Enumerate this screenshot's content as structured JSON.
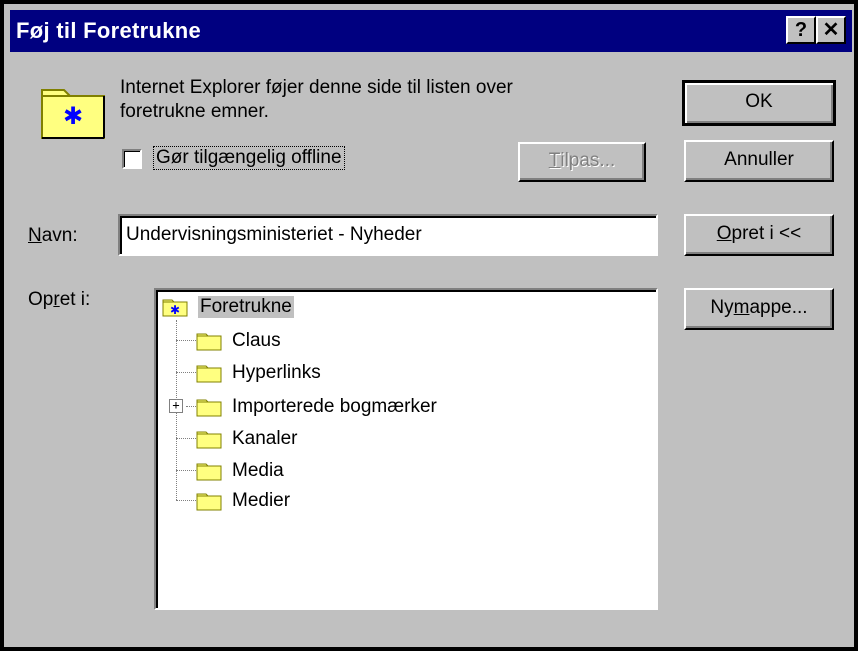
{
  "window": {
    "title": "Føj til Foretrukne",
    "help_glyph": "?",
    "close_glyph": "✕"
  },
  "info": {
    "line1": "Internet Explorer føjer denne side til listen over",
    "line2": "foretrukne emner."
  },
  "offline": {
    "label_pre": "G",
    "label_mid": "ø",
    "label_rest": "r tilgængelig offline",
    "checked": false
  },
  "buttons": {
    "tilpas_u": "T",
    "tilpas_rest": "ilpas...",
    "ok": "OK",
    "cancel": "Annuller",
    "create_in_u": "O",
    "create_in_rest": "pret i <<",
    "new_folder_pre": "Ny ",
    "new_folder_u": "m",
    "new_folder_rest": "appe..."
  },
  "name": {
    "label_u": "N",
    "label_rest": "avn:",
    "value": "Undervisningsministeriet - Nyheder"
  },
  "create_in": {
    "label_pre": "Op",
    "label_u": "r",
    "label_rest": "et i:"
  },
  "tree": {
    "root": "Foretrukne",
    "items": [
      "Claus",
      "Hyperlinks",
      "Importerede bogmærker",
      "Kanaler",
      "Media",
      "Medier"
    ],
    "expandable": "Importerede bogmærker"
  },
  "colors": {
    "titlebar": "#000080",
    "dialog": "#c0c0c0",
    "folder": "#ffff80"
  }
}
